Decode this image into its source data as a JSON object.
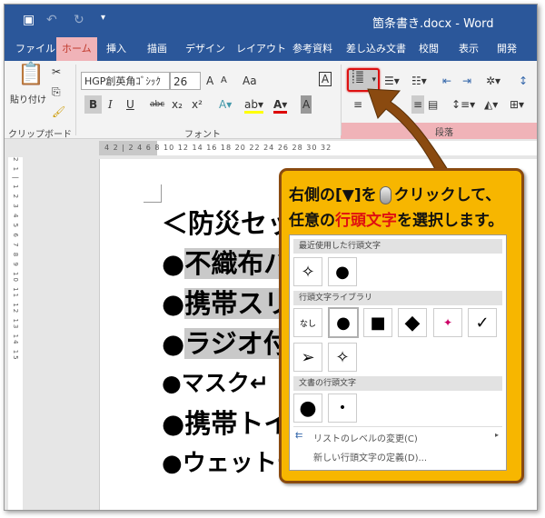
{
  "titlebar": {
    "doc_title": "箇条書き.docx  -  Word",
    "save_icon": "save-icon",
    "undo_icon": "undo-icon",
    "redo_icon": "redo-icon",
    "customize_icon": "customize-icon"
  },
  "tabs": [
    "ファイル",
    "ホーム",
    "挿入",
    "描画",
    "デザイン",
    "レイアウト",
    "参考資料",
    "差し込み文書",
    "校閲",
    "表示",
    "開発"
  ],
  "active_tab": "ホーム",
  "ribbon": {
    "clipboard": {
      "paste": "貼り付け",
      "label": "クリップボード"
    },
    "font": {
      "name": "HGP創英角ｺﾞｼｯｸ",
      "size": "26",
      "label": "フォント",
      "case": "Aa",
      "bold": "B",
      "italic": "I",
      "underline": "U",
      "strike": "abc",
      "sub": "x₂",
      "sup": "x²",
      "grow": "A",
      "shrink": "A"
    },
    "paragraph": {
      "label": "段落"
    }
  },
  "ruler": {
    "top": "4  2  |  2  4  6  8  10  12  14  16  18  20  22  24  26  28  30  32",
    "left": "2 1 | 1 2 3 4 5 6 7 8 9 10 11 12 13 14 15"
  },
  "document": {
    "lines": [
      {
        "text": "＜防災セッ",
        "selected": false,
        "bullet": ""
      },
      {
        "text": "不織布バ",
        "selected": true,
        "bullet": "●"
      },
      {
        "text": "携帯スリ",
        "selected": true,
        "bullet": "●"
      },
      {
        "text": "ラジオ付",
        "selected": true,
        "bullet": "●"
      },
      {
        "text": "マスク↵",
        "selected": false,
        "bullet": "●"
      },
      {
        "text": "携帯トイ",
        "selected": false,
        "bullet": "●"
      },
      {
        "text": "ウェットテ",
        "selected": false,
        "bullet": "●"
      }
    ]
  },
  "callout": {
    "line1_a": "右側の[▼]を",
    "line1_b": "クリックして、",
    "line2_a": "任意の",
    "line2_red": "行頭文字",
    "line2_b": "を選択します。",
    "accent": "#f7b600",
    "highlight": "#e01010"
  },
  "menu": {
    "recent": {
      "title": "最近使用した行頭文字",
      "items": [
        "✧",
        "●"
      ]
    },
    "library": {
      "title": "行頭文字ライブラリ",
      "items": [
        "なし",
        "●",
        "■",
        "◆",
        "✦",
        "✓",
        "➢",
        "✧"
      ]
    },
    "document": {
      "title": "文書の行頭文字",
      "items": [
        "●",
        "•"
      ]
    },
    "change_level": "リストのレベルの変更(C)",
    "define_new": "新しい行頭文字の定義(D)..."
  }
}
